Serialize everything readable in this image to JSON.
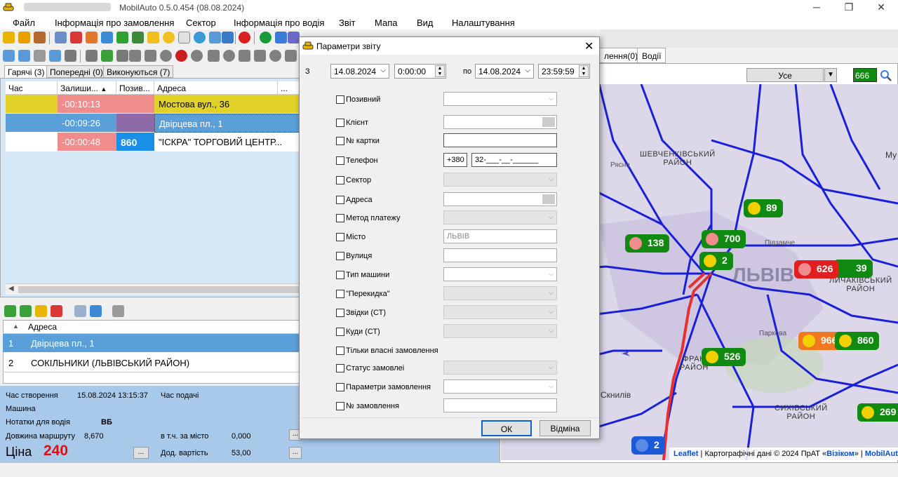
{
  "window": {
    "title": "MobilAuto 0.5.0.454 (08.08.2024)"
  },
  "menu": [
    "Файл",
    "Інформація про замовлення",
    "Сектор",
    "Інформація про водія",
    "Звіт",
    "Мапа",
    "Вид",
    "Налаштування"
  ],
  "order_tabs": [
    "Гарячі (3)",
    "Попередні (0)",
    "Виконуються (7)"
  ],
  "order_table": {
    "columns": [
      "Час замов...",
      "Залиши...",
      "Позив...",
      "Адреса",
      "..."
    ],
    "rows": [
      {
        "remain": "-00:10:13",
        "callsign": "",
        "address": "Мостова вул., 36"
      },
      {
        "remain": "-00:09:26",
        "callsign": "",
        "address": "Двірцева пл., 1"
      },
      {
        "remain": "-00:00:48",
        "callsign": "860",
        "address": "\"ІСКРА\" ТОРГОВИЙ ЦЕНТР..."
      }
    ]
  },
  "address_table": {
    "column": "Адреса",
    "rows": [
      {
        "n": "1",
        "address": "Двірцева пл., 1"
      },
      {
        "n": "2",
        "address": "СОКІЛЬНИКИ (ЛЬВІВСЬКИЙ РАЙОН)"
      }
    ]
  },
  "info": {
    "created_label": "Час створення",
    "created_value": "15.08.2024 13:15:37",
    "supply_label": "Час подачі",
    "car_label": "Машина",
    "notes_label": "Нотатки для водія",
    "notes_value": "ВБ",
    "route_label": "Довжина маршруту",
    "route_value": "8,670",
    "city_label": "в т.ч. за місто",
    "city_value": "0,000",
    "price_label": "Ціна",
    "price_value": "240",
    "extra_label": "Дод. вартість",
    "extra_value": "53,00",
    "dots": "..."
  },
  "right_tabs": [
    "лення(0)",
    "Водії"
  ],
  "map_filter": {
    "value": "Усе",
    "search_value": "666"
  },
  "map": {
    "districts": [
      "ШЕВЧЕНКІВСЬКИЙ\nРАЙОН",
      "ЛИЧАКІВСЬКИЙ\nРАЙОН",
      "ФРАН\nРАЙОН",
      "СИХІВСЬКИЙ\nРАЙОН",
      "ЛЬВІВ",
      "Рясне",
      "Підзамче",
      "Паркова",
      "Скнилів",
      "Му"
    ],
    "markers": [
      "89",
      "138",
      "700",
      "2",
      "626",
      "39",
      "966",
      "860",
      "526",
      "269",
      "2"
    ],
    "attribution": {
      "leaflet": "Leaflet",
      "data": " | Картографічні дані © 2024 ПрАТ «",
      "visicom": "Візіком",
      "close": "» | ",
      "mobilauto": "MobilAuto"
    }
  },
  "dialog": {
    "title": "Параметри звіту",
    "from_label": "З",
    "from_date": "14.08.2024",
    "from_time": "0:00:00",
    "to_label": "по",
    "to_date": "14.08.2024",
    "to_time": "23:59:59",
    "fields": [
      {
        "label": "Позивний"
      },
      {
        "label": "Клієнт"
      },
      {
        "label": "№ картки"
      },
      {
        "label": "Телефон",
        "prefix": "+380",
        "value": "32-___-__-______"
      },
      {
        "label": "Сектор"
      },
      {
        "label": "Адреса"
      },
      {
        "label": "Метод платежу"
      },
      {
        "label": "Місто",
        "placeholder": "ЛЬВІВ"
      },
      {
        "label": "Вулиця"
      },
      {
        "label": "Тип машини"
      },
      {
        "label": "\"Перекидка\""
      },
      {
        "label": "Звідки (СТ)"
      },
      {
        "label": "Куди (СТ)"
      },
      {
        "label": "Тільки власні замовлення"
      },
      {
        "label": "Статус замовлеі"
      },
      {
        "label": "Параметри замовлення"
      },
      {
        "label": "№ замовлення"
      }
    ],
    "ok": "ОК",
    "cancel": "Відміна"
  },
  "colors": {
    "hot_yellow": "#e2d128",
    "hot_red": "#f08c8c",
    "selected_blue": "#5a9fd8",
    "callsign_blue": "#1a8fe8",
    "marker_green": "#118a11",
    "marker_red": "#e02020",
    "marker_orange": "#f07820",
    "route": "#e83030",
    "road": "#1a20d8"
  }
}
